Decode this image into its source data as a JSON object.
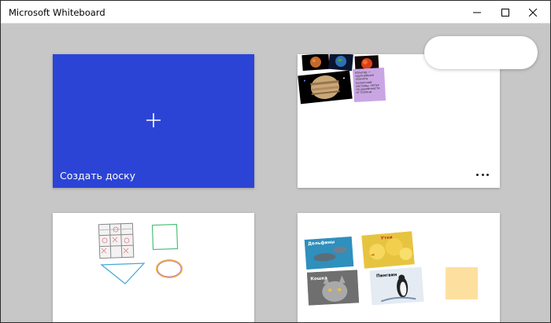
{
  "window": {
    "title": "Microsoft Whiteboard"
  },
  "titlebar_buttons": {
    "minimize": "minimize-icon",
    "maximize": "maximize-icon",
    "close": "close-icon"
  },
  "colors": {
    "new_board": "#2c44d6",
    "background": "#c7c7c7",
    "sticky_purple": "#c9a6e3",
    "sticky_yellow": "#fde0a0"
  },
  "new_board": {
    "label": "Создать доску",
    "icon": "plus-icon"
  },
  "boards": [
    {
      "name": "space-board",
      "note_text": "Юпитер — крупнейшая планета Солнечной системы, пятая по удалённости от Солнца.",
      "more_icon": "more-icon"
    },
    {
      "name": "shapes-board"
    },
    {
      "name": "animals-board",
      "captions": [
        "Дельфины",
        "Утки",
        "Кошка",
        "Пингвин"
      ]
    }
  ]
}
